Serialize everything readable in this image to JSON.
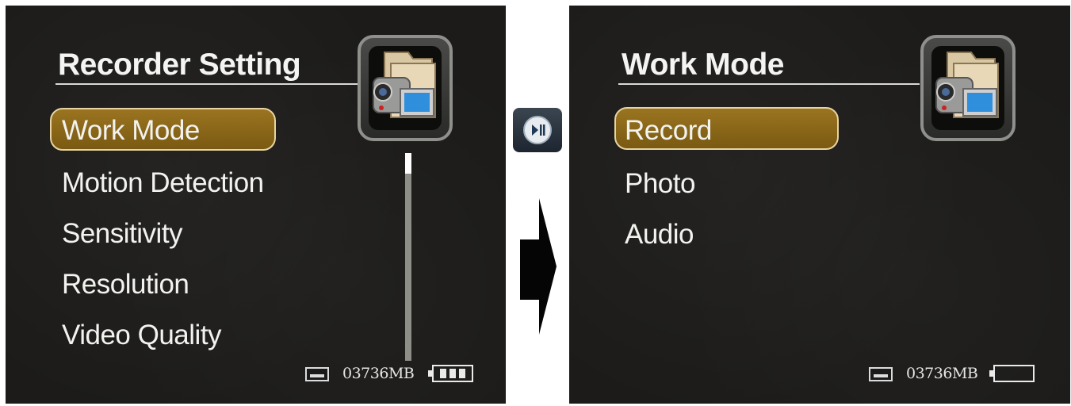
{
  "left_screen": {
    "title": "Recorder Setting",
    "menu_items": [
      "Work Mode",
      "Motion Detection",
      "Sensitivity",
      "Resolution",
      "Video Quality"
    ],
    "selected_index": 0,
    "storage": "03736MB",
    "icon": "camcorder-folder-icon",
    "battery_level": 0.66
  },
  "right_screen": {
    "title": "Work Mode",
    "menu_items": [
      "Record",
      "Photo",
      "Audio"
    ],
    "selected_index": 0,
    "storage": "03736MB",
    "icon": "camcorder-folder-icon",
    "battery_level": 0
  },
  "colors": {
    "highlight": "#8b6718",
    "highlight_border": "#e7d4a2",
    "background": "#1c1b19",
    "text": "#f2f2ef"
  }
}
